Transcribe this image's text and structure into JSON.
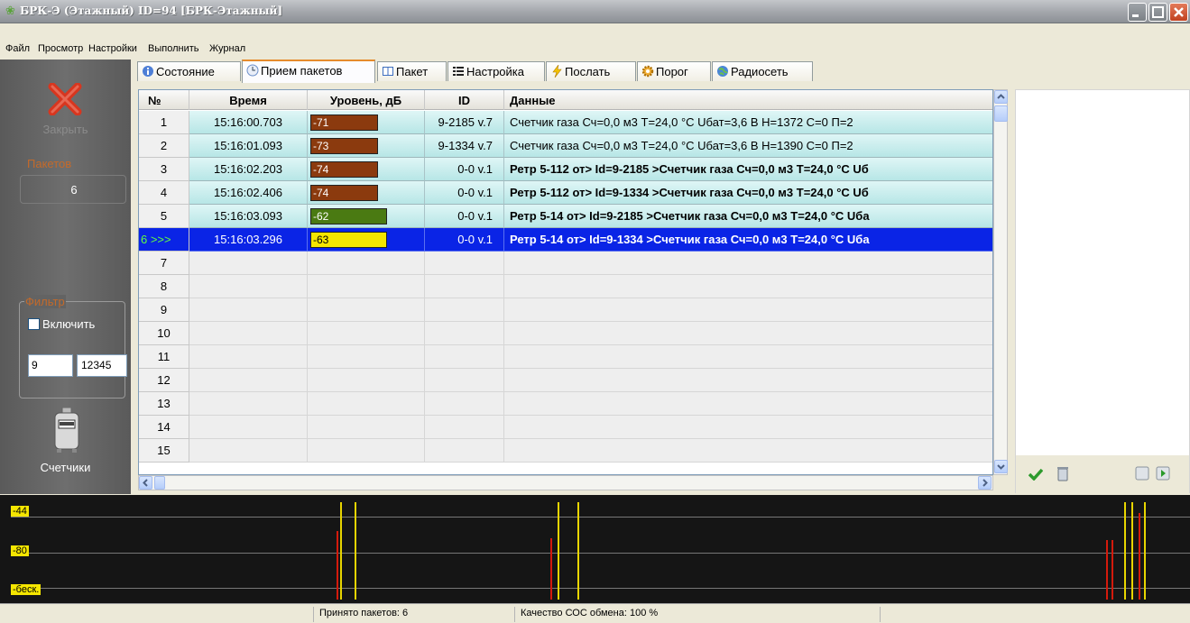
{
  "window": {
    "title": "БРК-Э  (Этажный)  ID=94 [БРК-Этажный]",
    "icon": "leaf-icon"
  },
  "menu": [
    "Файл",
    "Просмотр",
    "Настройки",
    "Выполнить",
    "Журнал"
  ],
  "left_panel": {
    "close_label": "Закрыть",
    "packets_label": "Пакетов",
    "packets_value": "6",
    "filter_label": "Фильтр",
    "filter_enable_label": "Включить",
    "filter_enabled": false,
    "filter_value_1": "9",
    "filter_value_2": "12345",
    "meters_label": "Счетчики"
  },
  "tabs": [
    {
      "label": "Состояние",
      "icon": "info-icon",
      "active": false
    },
    {
      "label": "Прием пакетов",
      "icon": "clock-icon",
      "active": true
    },
    {
      "label": "Пакет",
      "icon": "book-icon",
      "active": false
    },
    {
      "label": "Настройка",
      "icon": "list-icon",
      "active": false
    },
    {
      "label": "Послать",
      "icon": "lightning-icon",
      "active": false
    },
    {
      "label": "Порог",
      "icon": "gear-icon",
      "active": false
    },
    {
      "label": "Радиосеть",
      "icon": "globe-icon",
      "active": false
    }
  ],
  "grid": {
    "columns": [
      "№",
      "Время",
      "Уровень, дБ",
      "ID",
      "Данные"
    ],
    "rows": [
      {
        "num": "1",
        "time": "15:16:00.703",
        "level": "-71",
        "level_color": "#8b3a0e",
        "level_fill": 0.88,
        "id": "9-2185 v.7",
        "data": "Счетчик газа   Сч=0,0 м3 Т=24,0 °С Uбат=3,6 В Н=1372 С=0 П=2"
      },
      {
        "num": "2",
        "time": "15:16:01.093",
        "level": "-73",
        "level_color": "#8b3a0e",
        "level_fill": 0.88,
        "id": "9-1334 v.7",
        "data": "Счетчик газа   Сч=0,0 м3 Т=24,0 °С Uбат=3,6 В Н=1390 С=0 П=2"
      },
      {
        "num": "3",
        "time": "15:16:02.203",
        "level": "-74",
        "level_color": "#8b3a0e",
        "level_fill": 0.88,
        "id": "0-0 v.1",
        "data": "Ретр 5-112 от>  Id=9-2185 >Счетчик газа   Сч=0,0 м3 Т=24,0 °С Uб"
      },
      {
        "num": "4",
        "time": "15:16:02.406",
        "level": "-74",
        "level_color": "#8b3a0e",
        "level_fill": 0.88,
        "id": "0-0 v.1",
        "data": "Ретр 5-112 от>  Id=9-1334 >Счетчик газа   Сч=0,0 м3 Т=24,0 °С Uб"
      },
      {
        "num": "5",
        "time": "15:16:03.093",
        "level": "-62",
        "level_color": "#4a7a12",
        "level_fill": 1.0,
        "id": "0-0 v.1",
        "data": "Ретр 5-14 от>  Id=9-2185 >Счетчик газа   Сч=0,0 м3 Т=24,0 °С Uба"
      },
      {
        "num": "6 >>>",
        "time": "15:16:03.296",
        "level": "-63",
        "level_color": "#f5e600",
        "level_fill": 1.0,
        "id": "0-0 v.1",
        "data": "Ретр 5-14 от>  Id=9-1334 >Счетчик газа   Сч=0,0 м3 Т=24,0 °С Uба",
        "selected": true
      }
    ],
    "empty_rows": [
      "7",
      "8",
      "9",
      "10",
      "11",
      "12",
      "13",
      "14",
      "15"
    ]
  },
  "signal_panel": {
    "levels": [
      "-44",
      "-80",
      "-беск."
    ]
  },
  "status_bar": {
    "received": "Принято пакетов: 6",
    "quality": "Качество СОС обмена: 100 %"
  }
}
